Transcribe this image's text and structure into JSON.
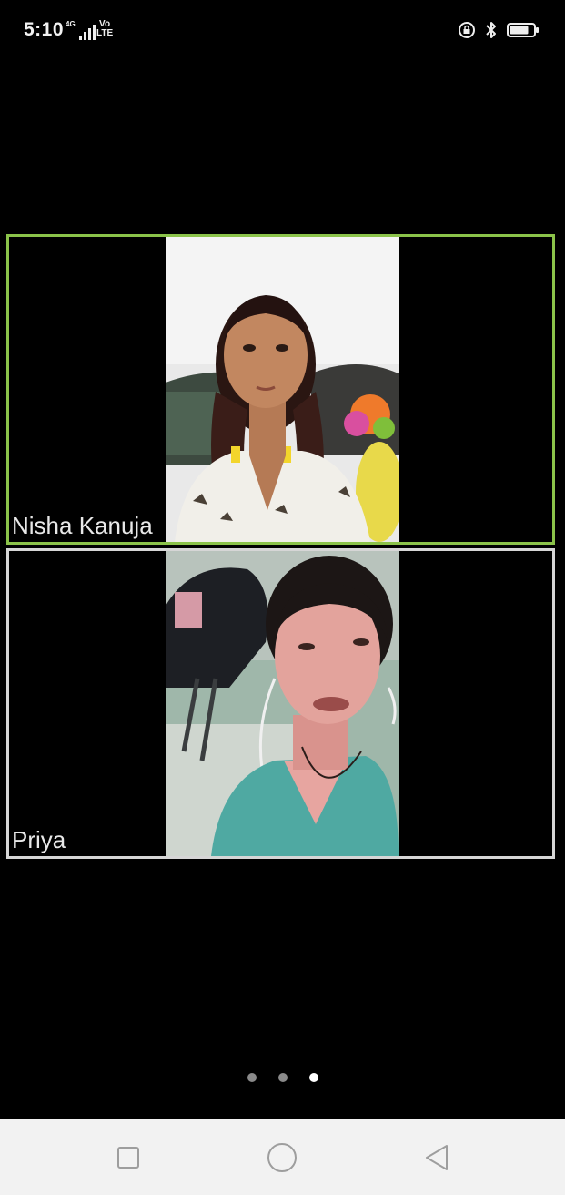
{
  "status_bar": {
    "time": "5:10",
    "network_label": "4G",
    "volte_line1": "Vo",
    "volte_line2": "LTE",
    "icons": [
      "data-arrows-icon",
      "signal-icon",
      "volte-icon",
      "screen-lock-rotation-icon",
      "bluetooth-icon",
      "battery-icon"
    ],
    "battery_level": 0.8
  },
  "participants": [
    {
      "name": "Nisha Kanuja",
      "active_speaker": true,
      "border_color": "#8bc34a"
    },
    {
      "name": "Priya",
      "active_speaker": false,
      "border_color": "#d6d6d6"
    }
  ],
  "pagination": {
    "total_pages": 3,
    "current_page": 3
  },
  "nav_bar": {
    "buttons": [
      "recents-square-icon",
      "home-circle-icon",
      "back-triangle-icon"
    ]
  }
}
